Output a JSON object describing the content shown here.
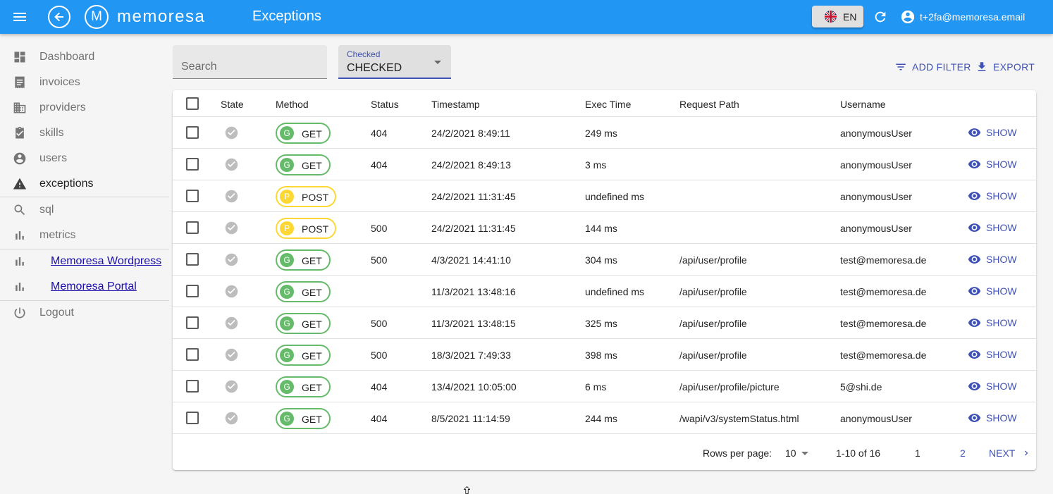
{
  "appbar": {
    "logo_letter": "M",
    "logo_text": "memoresa",
    "title": "Exceptions",
    "language": "EN",
    "user_email": "t+2fa@memoresa.email"
  },
  "sidebar": {
    "items": [
      {
        "label": "Dashboard",
        "icon": "dashboard-icon"
      },
      {
        "label": "invoices",
        "icon": "receipt-icon"
      },
      {
        "label": "providers",
        "icon": "business-icon"
      },
      {
        "label": "skills",
        "icon": "assignment-check-icon"
      },
      {
        "label": "users",
        "icon": "account-circle-icon"
      },
      {
        "label": "exceptions",
        "icon": "warning-icon",
        "active": true
      },
      {
        "label": "sql",
        "icon": "search-icon"
      },
      {
        "label": "metrics",
        "icon": "bar-chart-icon"
      },
      {
        "label": "Memoresa Wordpress",
        "icon": "bar-chart-icon"
      },
      {
        "label": "Memoresa Portal",
        "icon": "bar-chart-icon"
      },
      {
        "label": "Logout",
        "icon": "power-icon"
      }
    ]
  },
  "filters": {
    "search_placeholder": "Search",
    "checked_label": "Checked",
    "checked_value": "CHECKED",
    "add_filter": "ADD FILTER",
    "export": "EXPORT"
  },
  "table": {
    "headers": [
      "State",
      "Method",
      "Status",
      "Timestamp",
      "Exec Time",
      "Request Path",
      "Username"
    ],
    "show_label": "SHOW",
    "rows": [
      {
        "method": "GET",
        "method_initial": "G",
        "status": "404",
        "timestamp": "24/2/2021 8:49:11",
        "exec_time": "249 ms",
        "path": "",
        "username": "anonymousUser"
      },
      {
        "method": "GET",
        "method_initial": "G",
        "status": "404",
        "timestamp": "24/2/2021 8:49:13",
        "exec_time": "3 ms",
        "path": "",
        "username": "anonymousUser"
      },
      {
        "method": "POST",
        "method_initial": "P",
        "status": "",
        "timestamp": "24/2/2021 11:31:45",
        "exec_time": "undefined ms",
        "path": "",
        "username": "anonymousUser"
      },
      {
        "method": "POST",
        "method_initial": "P",
        "status": "500",
        "timestamp": "24/2/2021 11:31:45",
        "exec_time": "144 ms",
        "path": "",
        "username": "anonymousUser"
      },
      {
        "method": "GET",
        "method_initial": "G",
        "status": "500",
        "timestamp": "4/3/2021 14:41:10",
        "exec_time": "304 ms",
        "path": "/api/user/profile",
        "username": "test@memoresa.de"
      },
      {
        "method": "GET",
        "method_initial": "G",
        "status": "",
        "timestamp": "11/3/2021 13:48:16",
        "exec_time": "undefined ms",
        "path": "/api/user/profile",
        "username": "test@memoresa.de"
      },
      {
        "method": "GET",
        "method_initial": "G",
        "status": "500",
        "timestamp": "11/3/2021 13:48:15",
        "exec_time": "325 ms",
        "path": "/api/user/profile",
        "username": "test@memoresa.de"
      },
      {
        "method": "GET",
        "method_initial": "G",
        "status": "500",
        "timestamp": "18/3/2021 7:49:33",
        "exec_time": "398 ms",
        "path": "/api/user/profile",
        "username": "test@memoresa.de"
      },
      {
        "method": "GET",
        "method_initial": "G",
        "status": "404",
        "timestamp": "13/4/2021 10:05:00",
        "exec_time": "6 ms",
        "path": "/api/user/profile/picture",
        "username": "5@shi.de"
      },
      {
        "method": "GET",
        "method_initial": "G",
        "status": "404",
        "timestamp": "8/5/2021 11:14:59",
        "exec_time": "244 ms",
        "path": "/wapi/v3/systemStatus.html",
        "username": "anonymousUser"
      }
    ]
  },
  "pagination": {
    "rows_per_page_label": "Rows per page:",
    "rows_per_page": "10",
    "range": "1-10 of 16",
    "pages": [
      "1",
      "2"
    ],
    "next": "NEXT"
  },
  "colors": {
    "appbar": "#2196f3",
    "accent": "#3f51b5",
    "get": "#66bb6a",
    "post": "#fdd835"
  }
}
